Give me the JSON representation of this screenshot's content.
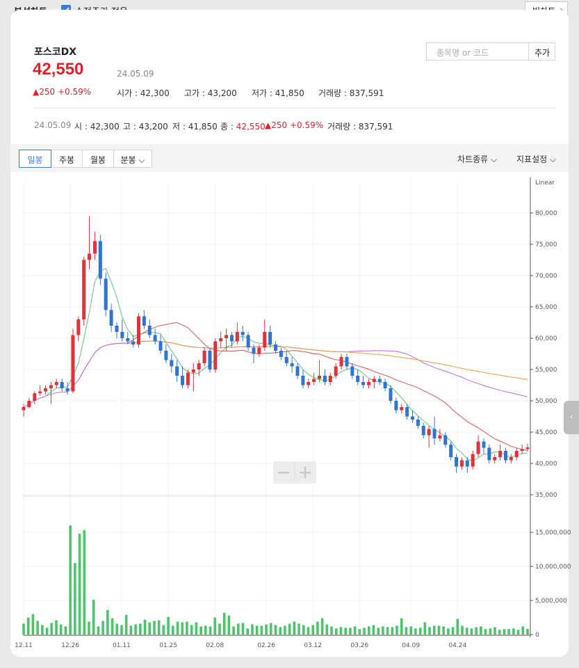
{
  "topbar": {
    "title": "분석차트",
    "checkbox_label": "수정주가 적용",
    "checkbox_checked": true,
    "big_chart": "빅차트"
  },
  "stock": {
    "name": "포스코DX",
    "price": "42,550",
    "date": "24.05.09",
    "change": "250",
    "change_pct": "+0.59%",
    "open_label": "시가",
    "open": "42,300",
    "high_label": "고가",
    "high": "43,200",
    "low_label": "저가",
    "low": "41,850",
    "volume_label": "거래량",
    "volume": "837,591"
  },
  "search": {
    "placeholder": "종목명 or 코드",
    "add": "추가"
  },
  "summary": {
    "date": "24.05.09",
    "open_label": "시",
    "open": "42,300",
    "high_label": "고",
    "high": "43,200",
    "low_label": "저",
    "low": "41,850",
    "close_label": "종",
    "close": "42,550",
    "change": "250",
    "change_pct": "+0.59%",
    "volume_label": "거래량",
    "volume": "837,591"
  },
  "tabs": [
    "일봉",
    "주봉",
    "월봉",
    "분봉"
  ],
  "tools": {
    "chart_type": "차트종류",
    "indicators": "지표설정"
  },
  "colors": {
    "up": "#e0323a",
    "down": "#2f74d0",
    "ma5": "#5cc37e",
    "ma20": "#d9534f",
    "ma60": "#b86ae0",
    "ma120": "#ea9a3e",
    "volume": "#4cc46c"
  },
  "chart_data": {
    "type": "candlestick",
    "scale": "Linear",
    "price_axis": {
      "ticks": [
        "80,000",
        "75,000",
        "70,000",
        "65,000",
        "60,000",
        "55,000",
        "50,000",
        "45,000",
        "40,000",
        "35,000"
      ],
      "ylim": [
        35000,
        81000
      ]
    },
    "volume_axis": {
      "ticks": [
        "15,000,000",
        "10,000,000",
        "5,000,000",
        "0"
      ],
      "ylim": [
        0,
        16000000
      ]
    },
    "x_ticks": [
      "12.11",
      "12.26",
      "01.11",
      "01.25",
      "02.08",
      "02.26",
      "03.12",
      "03.26",
      "04.09",
      "04.24"
    ],
    "candles": [
      [
        48500,
        49500,
        47500,
        49000
      ],
      [
        49000,
        50500,
        48800,
        50000
      ],
      [
        50000,
        51500,
        49500,
        51200
      ],
      [
        51200,
        52500,
        50800,
        51500
      ],
      [
        51500,
        52500,
        51000,
        52000
      ],
      [
        52000,
        53000,
        49500,
        52500
      ],
      [
        52500,
        53500,
        52000,
        53000
      ],
      [
        53000,
        53500,
        51500,
        52000
      ],
      [
        52000,
        53000,
        51000,
        51500
      ],
      [
        51500,
        61500,
        51200,
        60500
      ],
      [
        60500,
        63500,
        59500,
        63000
      ],
      [
        63000,
        73000,
        62000,
        72500
      ],
      [
        72500,
        79500,
        71000,
        73500
      ],
      [
        73500,
        77000,
        72500,
        75500
      ],
      [
        75500,
        76500,
        68500,
        69500
      ],
      [
        69500,
        70500,
        63500,
        64500
      ],
      [
        64500,
        65500,
        61000,
        62000
      ],
      [
        62000,
        62500,
        60000,
        61000
      ],
      [
        61000,
        63000,
        59500,
        60000
      ],
      [
        60000,
        61000,
        59000,
        59500
      ],
      [
        59500,
        60500,
        58500,
        59000
      ],
      [
        59000,
        64000,
        58500,
        63500
      ],
      [
        63500,
        64500,
        61500,
        62000
      ],
      [
        62000,
        63000,
        60000,
        60500
      ],
      [
        60500,
        61500,
        59000,
        59500
      ],
      [
        59500,
        60500,
        57500,
        58000
      ],
      [
        58000,
        59000,
        56000,
        56500
      ],
      [
        56500,
        57500,
        54500,
        55500
      ],
      [
        55500,
        56500,
        53000,
        54000
      ],
      [
        54000,
        55500,
        52000,
        52500
      ],
      [
        52500,
        55000,
        52000,
        54500
      ],
      [
        54500,
        56000,
        51500,
        55000
      ],
      [
        55000,
        56500,
        54000,
        56000
      ],
      [
        56000,
        58500,
        55500,
        58000
      ],
      [
        58000,
        58500,
        54500,
        55000
      ],
      [
        55000,
        60000,
        54500,
        59500
      ],
      [
        59500,
        61000,
        58500,
        60000
      ],
      [
        60000,
        61500,
        58000,
        60500
      ],
      [
        60500,
        61000,
        58500,
        59500
      ],
      [
        59500,
        62500,
        59000,
        61000
      ],
      [
        61000,
        62000,
        59500,
        60500
      ],
      [
        60500,
        61000,
        58000,
        58500
      ],
      [
        58500,
        59000,
        56000,
        57500
      ],
      [
        57500,
        59000,
        57000,
        58500
      ],
      [
        58500,
        63000,
        58000,
        61000
      ],
      [
        61000,
        62000,
        58500,
        59000
      ],
      [
        59000,
        59500,
        57500,
        58000
      ],
      [
        58000,
        58500,
        56500,
        57000
      ],
      [
        57000,
        58000,
        55500,
        56000
      ],
      [
        56000,
        57000,
        54500,
        55500
      ],
      [
        55500,
        56000,
        53500,
        54000
      ],
      [
        54000,
        55000,
        52000,
        52500
      ],
      [
        52500,
        53500,
        52000,
        53000
      ],
      [
        53000,
        54500,
        52500,
        53500
      ],
      [
        53500,
        56500,
        53000,
        54000
      ],
      [
        54000,
        55000,
        52500,
        53000
      ],
      [
        53000,
        54500,
        52500,
        54000
      ],
      [
        54000,
        56000,
        53500,
        55500
      ],
      [
        55500,
        57500,
        55000,
        57000
      ],
      [
        57000,
        57500,
        55000,
        55500
      ],
      [
        55500,
        56000,
        53500,
        54000
      ],
      [
        54000,
        55000,
        52500,
        53000
      ],
      [
        53000,
        54000,
        52000,
        52500
      ],
      [
        52500,
        53500,
        52000,
        53000
      ],
      [
        53000,
        54000,
        52000,
        53500
      ],
      [
        53500,
        54000,
        52500,
        53000
      ],
      [
        53000,
        53500,
        51500,
        52000
      ],
      [
        52000,
        52500,
        49500,
        50000
      ],
      [
        50000,
        50500,
        48000,
        48500
      ],
      [
        48500,
        49500,
        48000,
        49000
      ],
      [
        49000,
        49500,
        47000,
        47500
      ],
      [
        47500,
        48500,
        46500,
        47000
      ],
      [
        47000,
        47500,
        45500,
        46000
      ],
      [
        46000,
        46500,
        44000,
        44500
      ],
      [
        44500,
        46000,
        42500,
        45500
      ],
      [
        45500,
        47500,
        43000,
        44000
      ],
      [
        44000,
        45500,
        43500,
        44500
      ],
      [
        44500,
        45000,
        42500,
        43000
      ],
      [
        43000,
        43500,
        40500,
        41000
      ],
      [
        41000,
        41500,
        38500,
        39500
      ],
      [
        39500,
        41000,
        39000,
        40500
      ],
      [
        40500,
        41000,
        38500,
        39500
      ],
      [
        39500,
        42000,
        39000,
        41500
      ],
      [
        41500,
        44500,
        41000,
        43500
      ],
      [
        43500,
        44000,
        41500,
        42500
      ],
      [
        42500,
        43000,
        40000,
        40500
      ],
      [
        40500,
        41500,
        40000,
        41000
      ],
      [
        41000,
        43000,
        40500,
        42000
      ],
      [
        42000,
        42500,
        40000,
        40500
      ],
      [
        40500,
        41500,
        40000,
        41000
      ],
      [
        41000,
        42500,
        40500,
        42000
      ],
      [
        42000,
        43000,
        41500,
        42300
      ],
      [
        42300,
        43200,
        41850,
        42550
      ]
    ],
    "volumes": [
      1600000.0,
      2500000.0,
      3000000.0,
      2000000.0,
      1400000.0,
      1000000.0,
      1700000.0,
      2100000.0,
      1500000.0,
      1200000.0,
      16500000.0,
      10500000.0,
      14800000.0,
      15300000.0,
      1900000.0,
      5100000.0,
      1200000.0,
      2000000.0,
      3600000.0,
      2400000.0,
      1600000.0,
      1400000.0,
      2900000.0,
      1300000.0,
      1500000.0,
      1600000.0,
      2200000.0,
      1800000.0,
      2000000.0,
      2100000.0,
      1400000.0,
      2600000.0,
      1300000.0,
      1900000.0,
      1800000.0,
      1900000.0,
      1400000.0,
      1800000.0,
      1200000.0,
      1300000.0,
      1200000.0,
      2500000.0,
      1600000.0,
      3200000.0,
      2800000.0,
      1200000.0,
      1600000.0,
      1700000.0,
      900000.0,
      1500000.0,
      1300000.0,
      1300000.0,
      1500000.0,
      1700000.0,
      1400000.0,
      1100000.0,
      1300000.0,
      1600000.0,
      1900000.0,
      1600000.0,
      1400000.0,
      1100000.0,
      1400000.0,
      1900000.0,
      2400000.0,
      1500000.0,
      1200000.0,
      900000.0,
      1100000.0,
      1000000.0,
      1000000.0,
      1200000.0,
      800000.0,
      1000000.0,
      1200000.0,
      1400000.0,
      1000000.0,
      1200000.0,
      1100000.0,
      1100000.0,
      1300000.0,
      2400000.0,
      1100000.0,
      1200000.0,
      900000.0,
      1000000.0,
      1800000.0,
      1100000.0,
      1300000.0,
      1300000.0,
      1200000.0,
      900000.0,
      1100000.0,
      2300000.0,
      1300000.0,
      1000000.0,
      900000.0,
      1100000.0,
      1200000.0,
      800000.0,
      900000.0,
      1100000.0,
      700000.0,
      800000.0,
      800000.0,
      900000.0,
      700000.0,
      1200000.0,
      840000.0
    ]
  }
}
